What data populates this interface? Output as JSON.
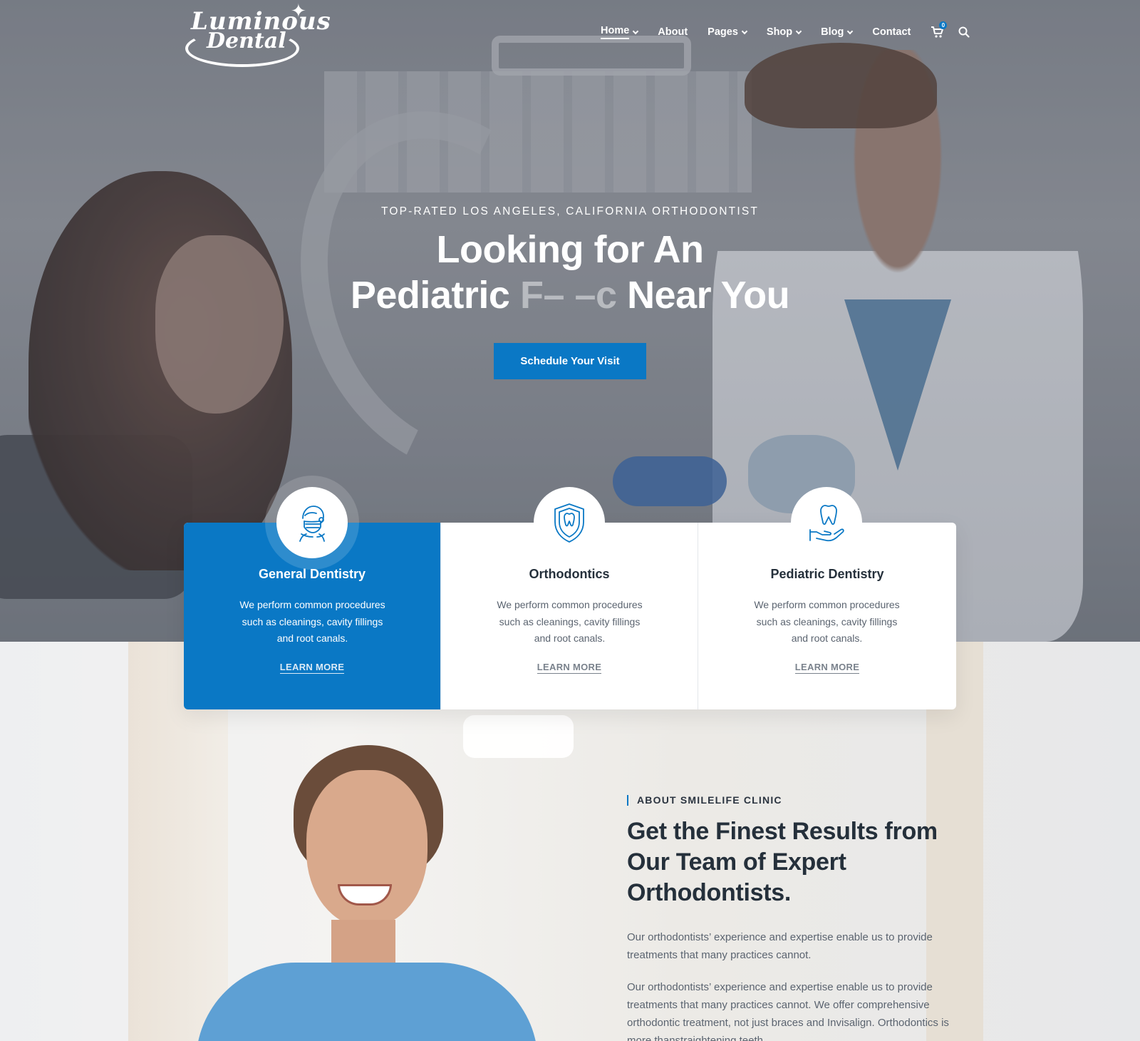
{
  "brand": {
    "line1": "Luminous",
    "line2": "Dental"
  },
  "nav": {
    "items": [
      {
        "label": "Home",
        "dropdown": true,
        "active": true
      },
      {
        "label": "About",
        "dropdown": false
      },
      {
        "label": "Pages",
        "dropdown": true
      },
      {
        "label": "Shop",
        "dropdown": true
      },
      {
        "label": "Blog",
        "dropdown": true
      },
      {
        "label": "Contact",
        "dropdown": false
      }
    ],
    "cart_count": "0"
  },
  "hero": {
    "eyebrow": "TOP-RATED LOS ANGELES, CALIFORNIA ORTHODONTIST",
    "title_line1": "Looking for An",
    "title_word": "Pediatric",
    "title_ghost": "F– –c",
    "title_end": "Near You",
    "cta": "Schedule Your Visit"
  },
  "services": [
    {
      "title": "General Dentistry",
      "text": "We perform common procedures such as cleanings, cavity fillings and root canals.",
      "link": "LEARN MORE",
      "icon": "dentist-mask-icon"
    },
    {
      "title": "Orthodontics",
      "text": "We perform common procedures such as cleanings, cavity fillings and root canals.",
      "link": "LEARN MORE",
      "icon": "tooth-shield-icon"
    },
    {
      "title": "Pediatric Dentistry",
      "text": "We perform common procedures such as cleanings, cavity fillings and root canals.",
      "link": "LEARN MORE",
      "icon": "tooth-hand-icon"
    }
  ],
  "about": {
    "eyebrow": "ABOUT SMILELIFE CLINIC",
    "title": "Get the Finest Results from Our Team of Expert Orthodontists.",
    "p1": "Our orthodontists’ experience and expertise enable us to provide treatments that many practices cannot.",
    "p2": "Our orthodontists’ experience and expertise enable us to provide treatments that many practices cannot. We offer comprehensive orthodontic treatment, not just braces and Invisalign. Orthodontics is more thanstraightening teeth."
  },
  "colors": {
    "accent": "#0a78c5",
    "heading": "#25303b",
    "body": "#5b6470"
  }
}
